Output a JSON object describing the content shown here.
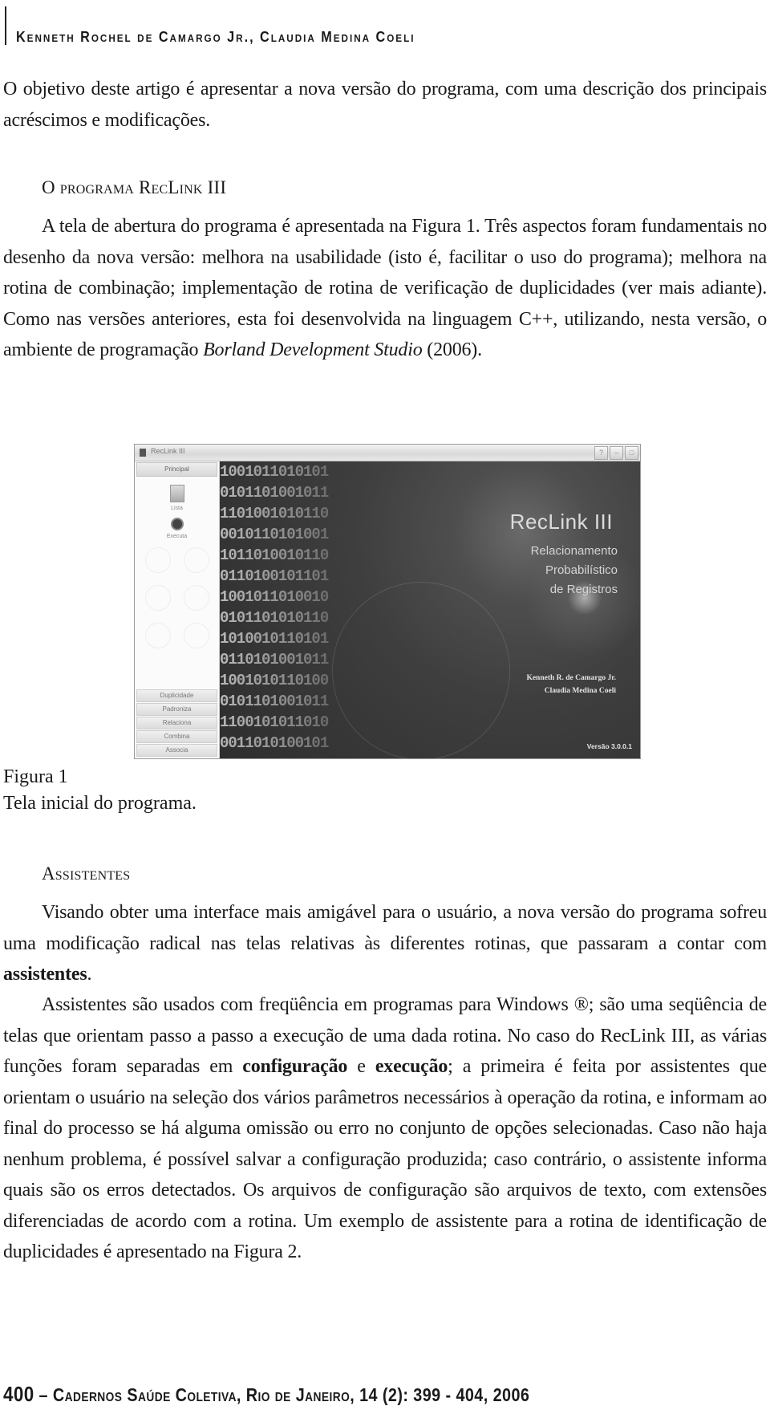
{
  "running_head": "Kenneth Rochel de Camargo Jr., Claudia Medina Coeli",
  "intro_paragraph": "O objetivo deste artigo é apresentar a nova versão do programa, com uma descrição dos principais acréscimos e modificações.",
  "section1": {
    "title": "O programa RecLink III",
    "paragraph": {
      "p1": "A tela de abertura do programa é apresentada na Figura 1. Três aspectos foram fundamentais no desenho da nova versão: melhora na usabilidade (isto é, facilitar o uso do programa); melhora na rotina de combinação; implementação de rotina de verificação de duplicidades (ver mais adiante). Como nas versões anteriores, esta foi desenvolvida na linguagem C++, utilizando, nesta versão, o ambiente de programação ",
      "italic": "Borland Development Studio",
      "p2": " (2006)."
    }
  },
  "figure1": {
    "window_title": "RecLink III",
    "window_buttons": [
      "?",
      "–",
      "□"
    ],
    "sidebar_header": "Principal",
    "sidebar_icons": [
      "Lista",
      "Executa"
    ],
    "sidebar_buttons": [
      "Duplicidade",
      "Padroniza",
      "Relaciona",
      "Combina",
      "Associa"
    ],
    "binary_pattern": "1001011010101\n0101101001011\n1101001010110\n0010110101001\n1011010010110\n0110100101101\n1001011010010\n0101101010110\n1010010110101\n0110101001011\n1001010110100\n0101101001011\n1100101011010\n0011010100101",
    "splash_title": "RecLink III",
    "splash_subtitle": [
      "Relacionamento",
      "Probabilístico",
      "de Registros"
    ],
    "splash_authors": [
      "Kenneth R. de Camargo Jr.",
      "Claudia Medina Coeli"
    ],
    "splash_version": "Versão 3.0.0.1",
    "label": "Figura 1",
    "caption": "Tela inicial do programa."
  },
  "section2": {
    "title": "Assistentes",
    "paragraph1": {
      "p1": "Visando obter uma interface mais amigável para o usuário, a nova versão do programa sofreu uma modificação radical nas telas relativas às diferentes rotinas, que passaram a contar com ",
      "bold": "assistentes",
      "p2": "."
    },
    "paragraph2": {
      "p1": "Assistentes são usados com freqüência em programas para Windows ®; são uma seqüência de telas que orientam passo a passo a execução de uma dada rotina. No caso do RecLink III, as várias funções foram separadas em ",
      "bold1": "configuração",
      "p2": " e ",
      "bold2": "execução",
      "p3": "; a primeira é feita por assistentes que orientam o usuário na seleção dos vários parâmetros necessários à operação da rotina, e informam ao final do processo se há alguma omissão ou erro no conjunto de opções selecionadas. Caso não haja nenhum problema, é possível salvar a configuração produzida; caso contrário, o assistente informa quais são os erros detectados. Os arquivos de configuração são arquivos de texto, com extensões diferenciadas de acordo com a rotina. Um exemplo de assistente para a rotina de identificação de duplicidades é apresentado na Figura 2."
    }
  },
  "footer": {
    "page_number": "400",
    "citation": " – Cadernos Saúde Coletiva, Rio de Janeiro, 14 (2): 399 - 404, 2006"
  }
}
